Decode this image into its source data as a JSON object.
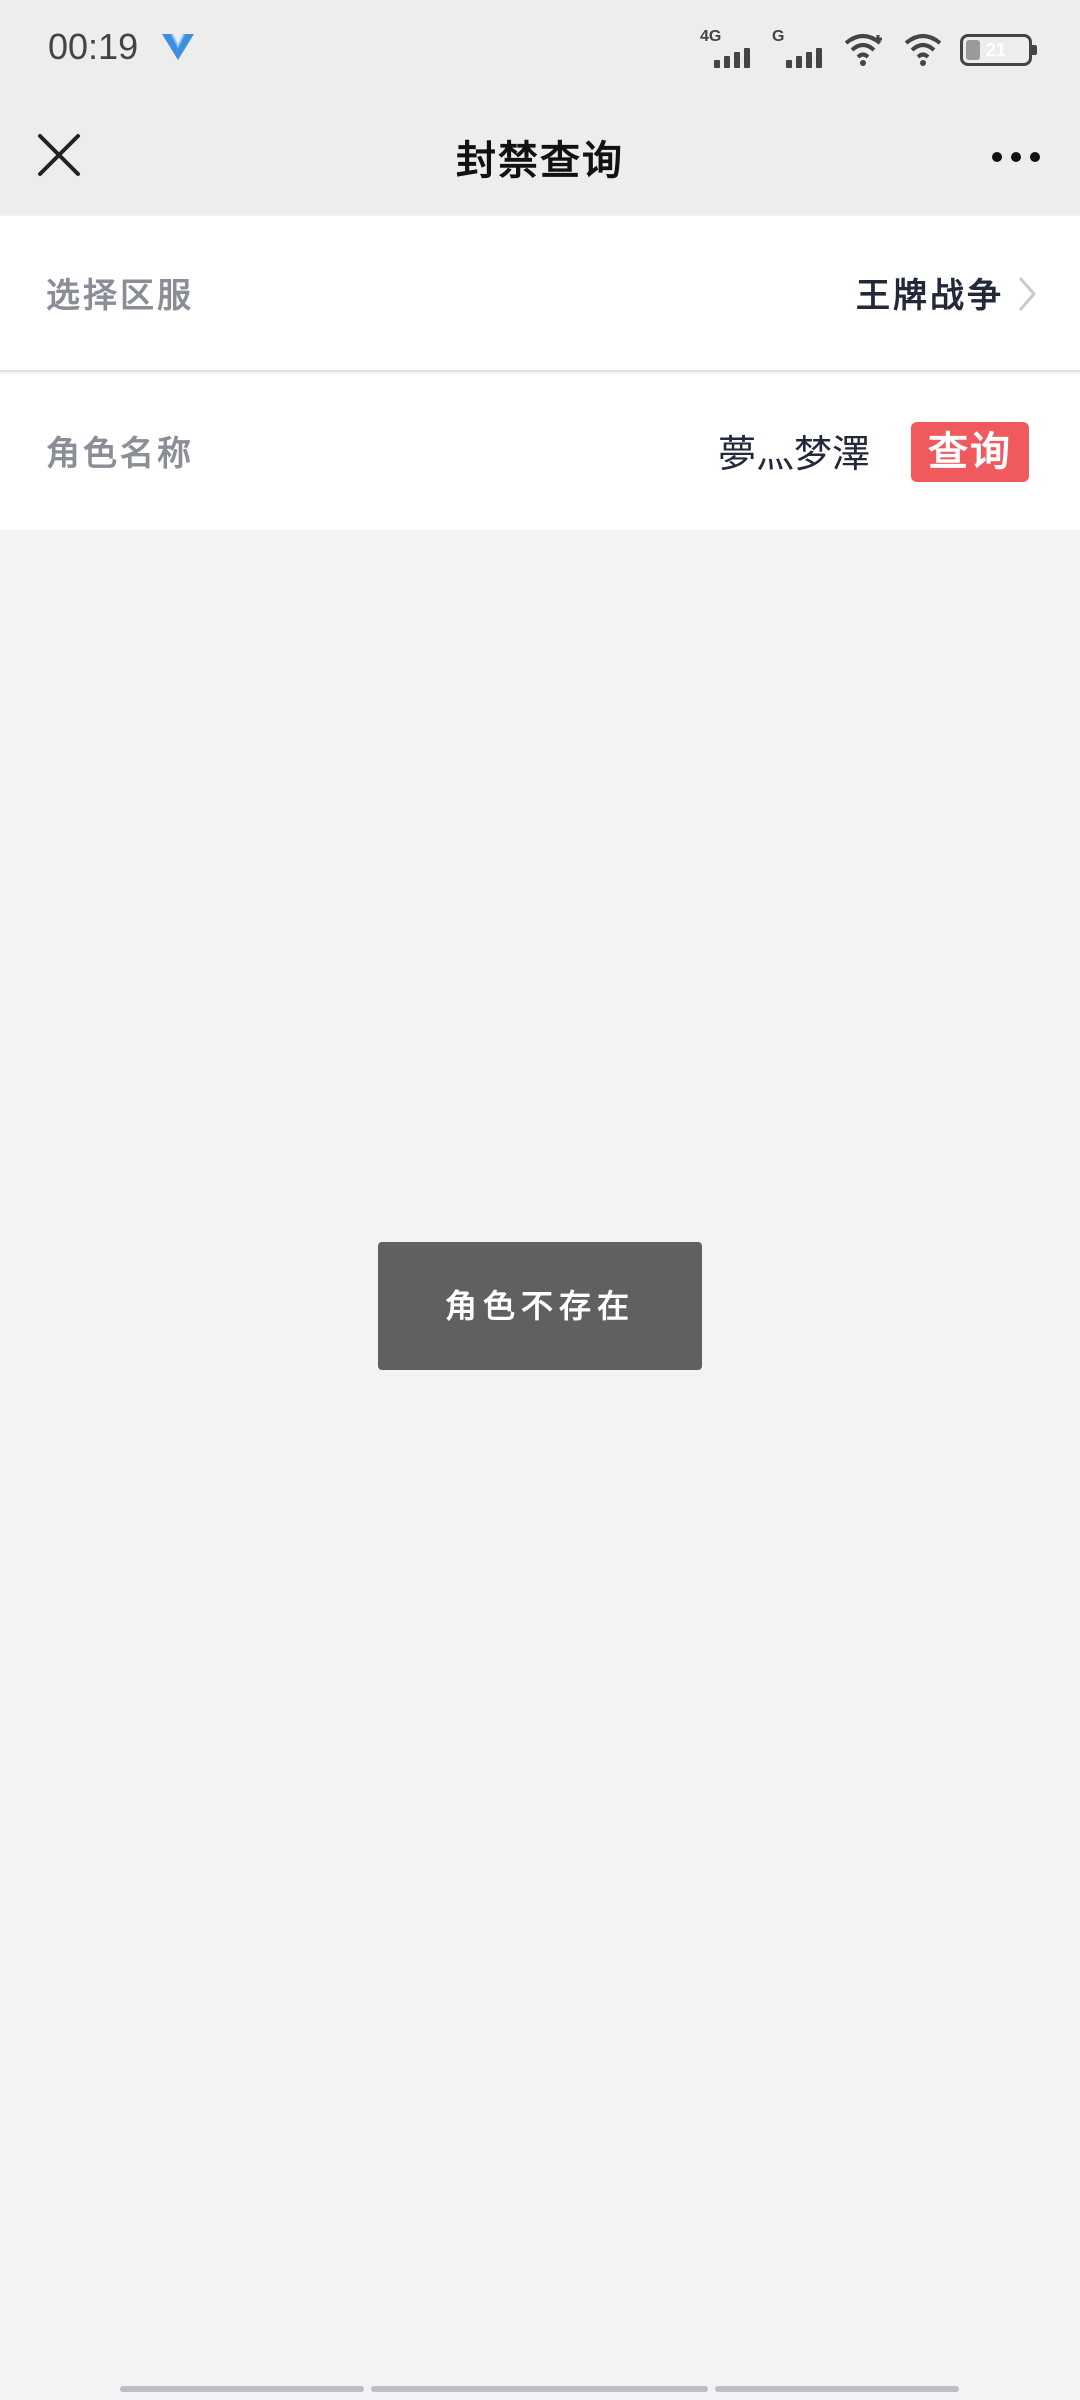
{
  "status_bar": {
    "time": "00:19",
    "network_1": "4G",
    "network_2": "G",
    "battery_level": "21"
  },
  "nav": {
    "title": "封禁查询"
  },
  "form": {
    "server_label": "选择区服",
    "server_value": "王牌战争",
    "role_label": "角色名称",
    "role_value": "夢灬梦澤",
    "query_button": "查询"
  },
  "toast": {
    "message": "角色不存在"
  },
  "colors": {
    "accent": "#f0595d",
    "toast_bg": "#5f6062",
    "label": "#8b8e96",
    "value": "#23283a"
  }
}
